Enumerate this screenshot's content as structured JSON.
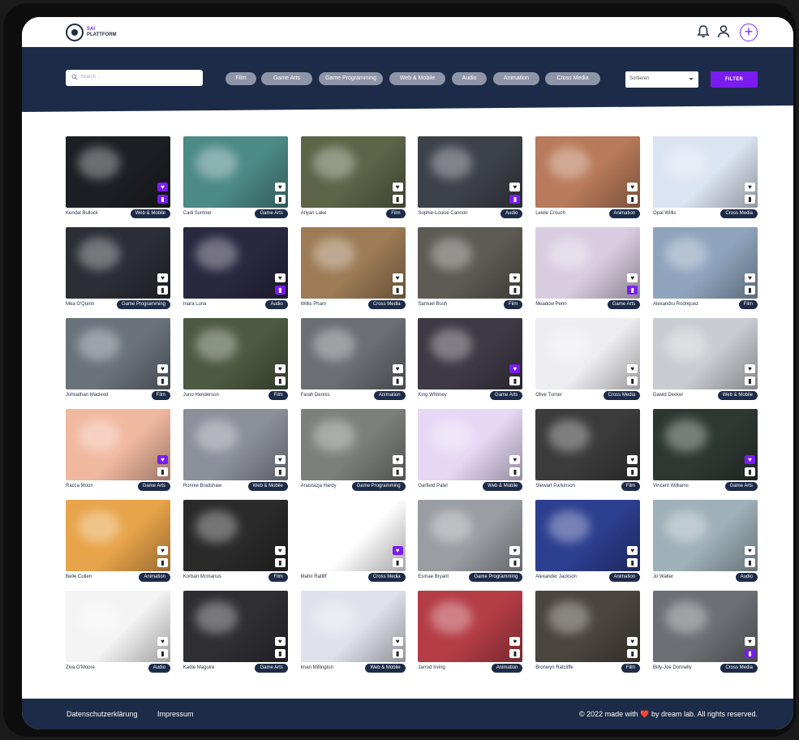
{
  "brand": {
    "line1": "SAI",
    "line2": "PLATTFORM"
  },
  "header": {
    "bell_icon": "bell-icon",
    "user_icon": "user-icon",
    "add_icon": "plus-icon",
    "add_label": "+"
  },
  "search": {
    "placeholder": "Search ..."
  },
  "categories": [
    "Film",
    "Game Arts",
    "Game Programming",
    "Web & Mobile",
    "Audio",
    "Animation",
    "Cross Media"
  ],
  "sort": {
    "label": "Sortieren"
  },
  "filter_button": "FILTER",
  "cards": [
    {
      "author": "Kendal Bullock",
      "tag": "Web & Mobile",
      "fav": true,
      "saved": true,
      "color": "#1d1f24"
    },
    {
      "author": "Cadi Sumner",
      "tag": "Game Arts",
      "fav": false,
      "saved": false,
      "color": "#4c8a87"
    },
    {
      "author": "Ariyan Lake",
      "tag": "Film",
      "fav": false,
      "saved": false,
      "color": "#5d6447"
    },
    {
      "author": "Sophie-Louise Cannon",
      "tag": "Audio",
      "fav": false,
      "saved": true,
      "color": "#3d4149"
    },
    {
      "author": "Lewie Crouch",
      "tag": "Animation",
      "fav": false,
      "saved": false,
      "color": "#b87a5a"
    },
    {
      "author": "Opal Willis",
      "tag": "Cross Media",
      "fav": false,
      "saved": false,
      "color": "#dbe4f2"
    },
    {
      "author": "Mea O'Quinn",
      "tag": "Game Programming",
      "fav": false,
      "saved": false,
      "color": "#2b2e35"
    },
    {
      "author": "Inara Luna",
      "tag": "Audio",
      "fav": false,
      "saved": true,
      "color": "#2a2741"
    },
    {
      "author": "Willis Pham",
      "tag": "Cross Media",
      "fav": false,
      "saved": false,
      "color": "#9c7b55"
    },
    {
      "author": "Samuel Bush",
      "tag": "Film",
      "fav": false,
      "saved": false,
      "color": "#5e5a54"
    },
    {
      "author": "Meadow Penn",
      "tag": "Game Arts",
      "fav": false,
      "saved": true,
      "color": "#d8cde0"
    },
    {
      "author": "Alexandru Rodriquez",
      "tag": "Film",
      "fav": false,
      "saved": false,
      "color": "#8ea4bd"
    },
    {
      "author": "Johnathan Macleod",
      "tag": "Film",
      "fav": false,
      "saved": false,
      "color": "#6a727b"
    },
    {
      "author": "Juno Henderson",
      "tag": "Film",
      "fav": false,
      "saved": false,
      "color": "#4d5940"
    },
    {
      "author": "Farah Dennis",
      "tag": "Animation",
      "fav": false,
      "saved": false,
      "color": "#6b6f74"
    },
    {
      "author": "King Whitney",
      "tag": "Game Arts",
      "fav": true,
      "saved": false,
      "color": "#3e3a45"
    },
    {
      "author": "Olive Turner",
      "tag": "Cross Media",
      "fav": false,
      "saved": false,
      "color": "#eeeef2"
    },
    {
      "author": "Dawid Decker",
      "tag": "Web & Mobile",
      "fav": false,
      "saved": false,
      "color": "#c9ccd1"
    },
    {
      "author": "Racca Moon",
      "tag": "Game Arts",
      "fav": true,
      "saved": false,
      "color": "#f1b8a0"
    },
    {
      "author": "Ronnie Bradshaw",
      "tag": "Web & Mobile",
      "fav": false,
      "saved": false,
      "color": "#8b8f99"
    },
    {
      "author": "Anastazja Hardy",
      "tag": "Game Programming",
      "fav": false,
      "saved": false,
      "color": "#7d7f7c"
    },
    {
      "author": "Garfield Patel",
      "tag": "Web & Mobile",
      "fav": false,
      "saved": false,
      "color": "#e6d7f5"
    },
    {
      "author": "Stewart Parkinson",
      "tag": "Film",
      "fav": false,
      "saved": false,
      "color": "#3b3b3b"
    },
    {
      "author": "Vincent Williams",
      "tag": "Game Arts",
      "fav": true,
      "saved": false,
      "color": "#2e3833"
    },
    {
      "author": "Belle Cullen",
      "tag": "Animation",
      "fav": false,
      "saved": false,
      "color": "#e8a44a"
    },
    {
      "author": "Korban Mcmanus",
      "tag": "Film",
      "fav": false,
      "saved": false,
      "color": "#2a2a2a"
    },
    {
      "author": "Mahir Ratliff",
      "tag": "Cross Media",
      "fav": true,
      "saved": false,
      "color": "#ffffff"
    },
    {
      "author": "Esmae Bryant",
      "tag": "Game Programming",
      "fav": false,
      "saved": false,
      "color": "#9a9da2"
    },
    {
      "author": "Alexander Jackson",
      "tag": "Animation",
      "fav": false,
      "saved": false,
      "color": "#2c3e8f"
    },
    {
      "author": "Jo Walter",
      "tag": "Audio",
      "fav": false,
      "saved": false,
      "color": "#9eb0b8"
    },
    {
      "author": "Ziva O'Moore",
      "tag": "Audio",
      "fav": false,
      "saved": false,
      "color": "#f4f4f4"
    },
    {
      "author": "Kadie Maguire",
      "tag": "Game Arts",
      "fav": false,
      "saved": false,
      "color": "#2f2e33"
    },
    {
      "author": "Iman Millington",
      "tag": "Web & Mobile",
      "fav": false,
      "saved": false,
      "color": "#dfe2ea"
    },
    {
      "author": "Jarrod Irving",
      "tag": "Animation",
      "fav": false,
      "saved": false,
      "color": "#b53d46"
    },
    {
      "author": "Bronwyn Ratcliffe",
      "tag": "Film",
      "fav": false,
      "saved": false,
      "color": "#4a453f"
    },
    {
      "author": "Billy-Joe Donnelly",
      "tag": "Cross Media",
      "fav": false,
      "saved": true,
      "color": "#6c6f74"
    }
  ],
  "footer": {
    "privacy": "Datenschutzerklärung",
    "imprint": "Impressum",
    "copy_before": "© 2022 made with",
    "heart": "❤️",
    "copy_after": "by dream lab. All rights reserved."
  }
}
